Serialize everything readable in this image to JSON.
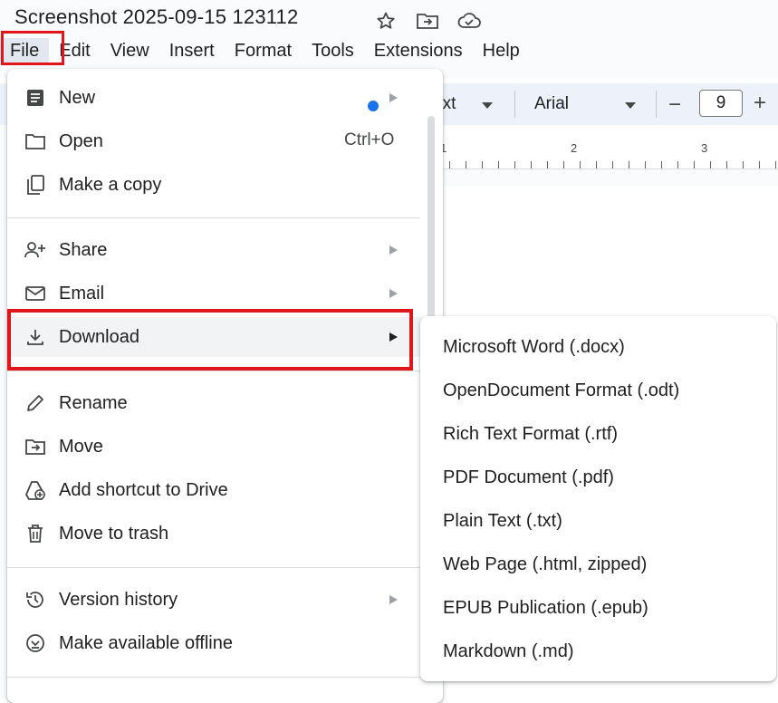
{
  "doc": {
    "title": "Screenshot 2025-09-15 123112"
  },
  "menubar": {
    "items": [
      {
        "label": "File"
      },
      {
        "label": "Edit"
      },
      {
        "label": "View"
      },
      {
        "label": "Insert"
      },
      {
        "label": "Format"
      },
      {
        "label": "Tools"
      },
      {
        "label": "Extensions"
      },
      {
        "label": "Help"
      }
    ]
  },
  "toolbar": {
    "style_text": "ext",
    "font": "Arial",
    "font_size": "9",
    "minus": "−",
    "plus": "+"
  },
  "ruler": {
    "labels": [
      "1",
      "2",
      "3"
    ]
  },
  "file_menu": {
    "items": [
      {
        "label": "New",
        "icon": "document-icon"
      },
      {
        "label": "Open",
        "icon": "folder-icon",
        "shortcut": "Ctrl+O"
      },
      {
        "label": "Make a copy",
        "icon": "copy-icon"
      },
      {
        "label": "Share",
        "icon": "person-add-icon"
      },
      {
        "label": "Email",
        "icon": "mail-icon"
      },
      {
        "label": "Download",
        "icon": "download-icon"
      },
      {
        "label": "Rename",
        "icon": "pencil-icon"
      },
      {
        "label": "Move",
        "icon": "folder-move-icon"
      },
      {
        "label": "Add shortcut to Drive",
        "icon": "drive-shortcut-icon"
      },
      {
        "label": "Move to trash",
        "icon": "trash-icon"
      },
      {
        "label": "Version history",
        "icon": "history-icon"
      },
      {
        "label": "Make available offline",
        "icon": "offline-icon"
      }
    ]
  },
  "download_submenu": {
    "items": [
      {
        "label": "Microsoft Word (.docx)"
      },
      {
        "label": "OpenDocument Format (.odt)"
      },
      {
        "label": "Rich Text Format (.rtf)"
      },
      {
        "label": "PDF Document (.pdf)"
      },
      {
        "label": "Plain Text (.txt)"
      },
      {
        "label": "Web Page (.html, zipped)"
      },
      {
        "label": "EPUB Publication (.epub)"
      },
      {
        "label": "Markdown (.md)"
      }
    ]
  },
  "colors": {
    "highlight": "#e0161b",
    "new_dot": "#1a73e8"
  }
}
